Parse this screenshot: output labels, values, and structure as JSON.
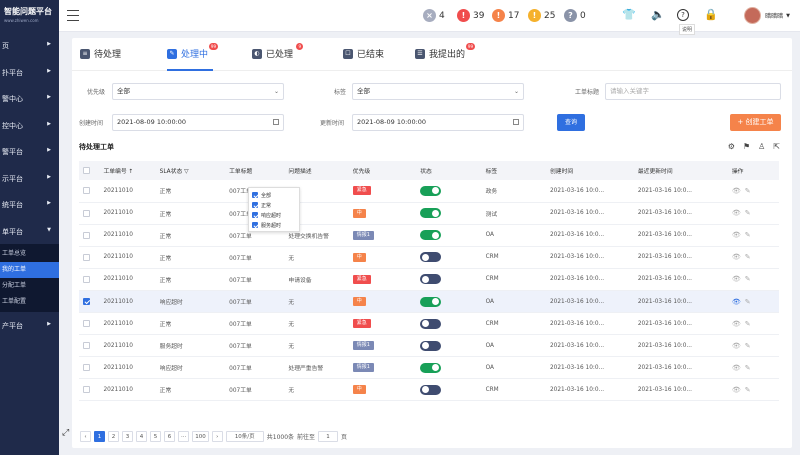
{
  "sidebar": {
    "logo_title": "智能问题平台",
    "logo_sub": "www.zhiwen.com",
    "items": [
      {
        "label": "页"
      },
      {
        "label": "扑平台"
      },
      {
        "label": "警中心"
      },
      {
        "label": "控中心"
      },
      {
        "label": "警平台"
      },
      {
        "label": "示平台"
      },
      {
        "label": "统平台"
      },
      {
        "label": "单平台"
      }
    ],
    "sub_items": [
      {
        "label": "工单总览"
      },
      {
        "label": "我的工单"
      },
      {
        "label": "分配工单"
      },
      {
        "label": "工单配置"
      }
    ],
    "after_items": [
      {
        "label": "产平台"
      }
    ]
  },
  "topbar": {
    "badges": [
      {
        "icon": "×",
        "count": "4",
        "color": "#a7adbf"
      },
      {
        "icon": "!",
        "count": "39",
        "color": "#f04d4d"
      },
      {
        "icon": "!",
        "count": "17",
        "color": "#f5834a"
      },
      {
        "icon": "!",
        "count": "25",
        "color": "#f5b12c"
      },
      {
        "icon": "?",
        "count": "0",
        "color": "#8a93a8"
      }
    ],
    "tooltip": "说明",
    "user": "暗暗暗"
  },
  "tabs": [
    {
      "label": "待处理",
      "badge": ""
    },
    {
      "label": "处理中",
      "badge": "99"
    },
    {
      "label": "已处理",
      "badge": "9"
    },
    {
      "label": "已结束",
      "badge": ""
    },
    {
      "label": "我提出的",
      "badge": "99"
    }
  ],
  "filters": {
    "priority_label": "优先级",
    "priority_value": "全部",
    "tag_label": "标签",
    "tag_value": "全部",
    "title_label": "工单标题",
    "title_placeholder": "请输入关键字",
    "created_label": "创建时间",
    "created_value": "2021-08-09 10:00:00",
    "updated_label": "更新时间",
    "updated_value": "2021-08-09 10:00:00",
    "search_btn": "查询",
    "create_btn": "+ 创建工单"
  },
  "section_title": "待处理工单",
  "table": {
    "headers": [
      "",
      "工单编号 ↑",
      "SLA状态 ▽",
      "工单标题",
      "问题描述",
      "优先级",
      "状态",
      "标签",
      "创建时间",
      "最近更新时间",
      "操作"
    ],
    "rows": [
      {
        "id": "20211010",
        "sla": "正常",
        "title": "007工单",
        "desc": "无",
        "pri": "紧急",
        "status": "on",
        "tag": "政务",
        "created": "2021-03-16 10:0...",
        "updated": "2021-03-16 10:0...",
        "selected": false
      },
      {
        "id": "20211010",
        "sla": "正常",
        "title": "007工单",
        "desc": "无",
        "pri": "中",
        "status": "on",
        "tag": "测试",
        "created": "2021-03-16 10:0...",
        "updated": "2021-03-16 10:0...",
        "selected": false
      },
      {
        "id": "20211010",
        "sla": "正常",
        "title": "007工单",
        "desc": "处理交换机告警",
        "pri": "情报1",
        "status": "on",
        "tag": "OA",
        "created": "2021-03-16 10:0...",
        "updated": "2021-03-16 10:0...",
        "selected": false
      },
      {
        "id": "20211010",
        "sla": "正常",
        "title": "007工单",
        "desc": "无",
        "pri": "中",
        "status": "off",
        "tag": "CRM",
        "created": "2021-03-16 10:0...",
        "updated": "2021-03-16 10:0...",
        "selected": false
      },
      {
        "id": "20211010",
        "sla": "正常",
        "title": "007工单",
        "desc": "申请设备",
        "pri": "紧急",
        "status": "off",
        "tag": "CRM",
        "created": "2021-03-16 10:0...",
        "updated": "2021-03-16 10:0...",
        "selected": false
      },
      {
        "id": "20211010",
        "sla": "响应超时",
        "title": "007工单",
        "desc": "无",
        "pri": "中",
        "status": "on",
        "tag": "OA",
        "created": "2021-03-16 10:0...",
        "updated": "2021-03-16 10:0...",
        "selected": true
      },
      {
        "id": "20211010",
        "sla": "正常",
        "title": "007工单",
        "desc": "无",
        "pri": "紧急",
        "status": "off",
        "tag": "CRM",
        "created": "2021-03-16 10:0...",
        "updated": "2021-03-16 10:0...",
        "selected": false
      },
      {
        "id": "20211010",
        "sla": "服务超时",
        "title": "007工单",
        "desc": "无",
        "pri": "情报1",
        "status": "off",
        "tag": "OA",
        "created": "2021-03-16 10:0...",
        "updated": "2021-03-16 10:0...",
        "selected": false
      },
      {
        "id": "20211010",
        "sla": "响应超时",
        "title": "007工单",
        "desc": "处理严重告警",
        "pri": "情报1",
        "status": "on",
        "tag": "OA",
        "created": "2021-03-16 10:0...",
        "updated": "2021-03-16 10:0...",
        "selected": false
      },
      {
        "id": "20211010",
        "sla": "正常",
        "title": "007工单",
        "desc": "无",
        "pri": "中",
        "status": "off",
        "tag": "CRM",
        "created": "2021-03-16 10:0...",
        "updated": "2021-03-16 10:0...",
        "selected": false
      }
    ]
  },
  "sla_popup": [
    "全部",
    "正常",
    "响应超时",
    "服务超时"
  ],
  "pager": {
    "pages": [
      "1",
      "2",
      "3",
      "4",
      "5",
      "6",
      "···",
      "100"
    ],
    "per_page": "10条/页",
    "total": "共1000条",
    "goto_label": "前往至",
    "goto_value": "1",
    "page_suffix": "页"
  },
  "colors": {
    "primary": "#2f6fe0",
    "urgent": "#f04d4d",
    "medium": "#f5834a",
    "info": "#7b89b5",
    "on": "#18a058",
    "off": "#3f4c70"
  }
}
